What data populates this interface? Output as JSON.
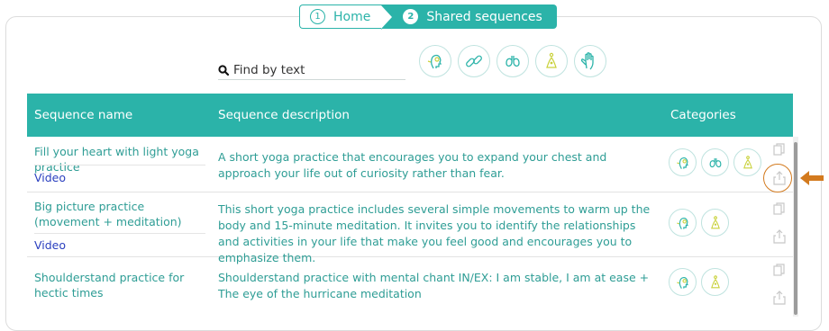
{
  "breadcrumb": {
    "home": {
      "num": "1",
      "label": "Home"
    },
    "shared": {
      "num": "2",
      "label": "Shared sequences"
    }
  },
  "search": {
    "placeholder": "Find by text"
  },
  "filters": [
    "head-icon",
    "link-icon",
    "lungs-icon",
    "body-center-icon",
    "hand-icon"
  ],
  "table": {
    "headers": {
      "name": "Sequence name",
      "description": "Sequence description",
      "categories": "Categories"
    },
    "rows": [
      {
        "name": "Fill your heart with light yoga practice",
        "video": "Video",
        "description": "A short yoga practice that encourages you to expand your chest and approach your life out of curiosity rather than fear.",
        "categories": [
          "head-icon",
          "lungs-icon",
          "body-center-icon"
        ]
      },
      {
        "name": "Big picture practice (movement + meditation)",
        "video": "Video",
        "description": "This short yoga practice includes several simple movements to warm up the body and 15-minute meditation. It invites you to identify the relationships and activities in your life that make you feel good and encourages you to emphasize them.",
        "categories": [
          "head-icon",
          "body-center-icon"
        ]
      },
      {
        "name": "Shoulderstand practice for hectic times",
        "video": "",
        "description": "Shoulderstand practice with mental chant IN/EX: I am stable, I am at ease + The eye of the hurricane meditation",
        "categories": [
          "head-icon",
          "body-center-icon"
        ]
      }
    ]
  },
  "colors": {
    "accent": "#2bb3a9",
    "highlight": "#d37a1e",
    "link": "#2a3fbf"
  }
}
